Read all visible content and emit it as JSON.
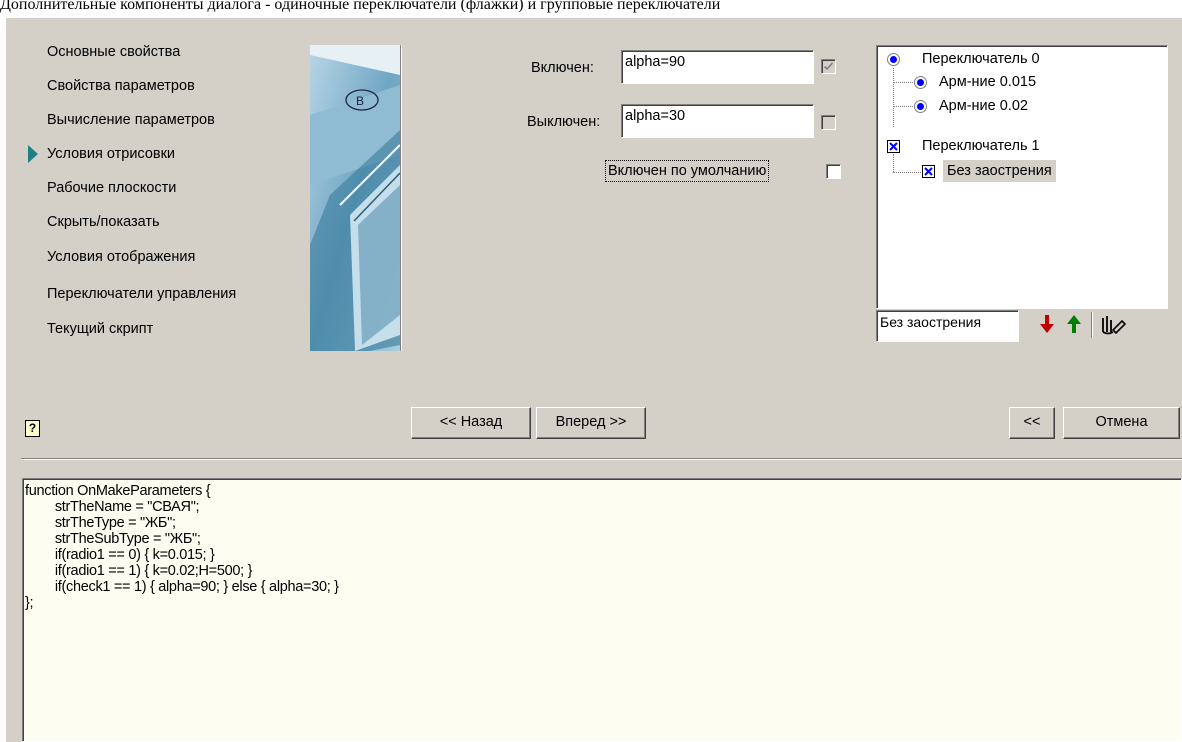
{
  "caption": "Дополнительные компоненты диалога - одиночные переключатели (флажки) и групповые переключатели",
  "nav": {
    "items": [
      {
        "label": "Основные свойства"
      },
      {
        "label": "Свойства параметров"
      },
      {
        "label": "Вычисление параметров"
      },
      {
        "label": "Условия отрисовки"
      },
      {
        "label": "Рабочие плоскости"
      },
      {
        "label": "Скрыть/показать"
      },
      {
        "label": "Условия отображения"
      },
      {
        "label": "Переключатели управления"
      },
      {
        "label": "Текущий скрипт"
      }
    ],
    "active_index": 3,
    "banner_badge": "В"
  },
  "form": {
    "on_label": "Включен:",
    "on_value": "alpha=90",
    "on_checked": true,
    "off_label": "Выключен:",
    "off_value": "alpha=30",
    "off_checked": false,
    "default_label": "Включен по умолчанию",
    "default_checked": false
  },
  "tree": {
    "nodes": [
      {
        "label": "Переключатель 0",
        "kind": "radio-group"
      },
      {
        "label": "Арм-ние 0.015",
        "kind": "radio"
      },
      {
        "label": "Арм-ние 0.02",
        "kind": "radio"
      },
      {
        "label": "Переключатель 1",
        "kind": "check-group"
      },
      {
        "label": "Без заострения",
        "kind": "check",
        "selected": true
      }
    ],
    "edit_value": "Без заострения"
  },
  "tree_tools": {
    "down_icon": "red-arrow-down-icon",
    "up_icon": "green-arrow-up-icon",
    "rename_icon": "hand-edit-icon"
  },
  "buttons": {
    "help": "?",
    "back": "<< Назад",
    "next": "Вперед >>",
    "collapse": "<<",
    "cancel": "Отмена"
  },
  "code": {
    "lines": [
      "function OnMakeParameters {",
      "\t\tstrTheName = \"СВАЯ\";",
      "\t\tstrTheType = \"ЖБ\";",
      "\t\tstrTheSubType = \"ЖБ\";",
      "\t\tif(radio1 == 0) { k=0.015; }",
      "\t\tif(radio1 == 1) { k=0.02;H=500; }",
      "\t\tif(check1 == 1) { alpha=90; } else { alpha=30; }",
      "};"
    ]
  },
  "colors": {
    "dialog_bg": "#d4d0c8",
    "code_bg": "#fdfdf1",
    "accent_arrow": "#1f7f86",
    "radio_blue": "#0000ff",
    "down_arrow": "#c00000",
    "up_arrow": "#008000"
  }
}
